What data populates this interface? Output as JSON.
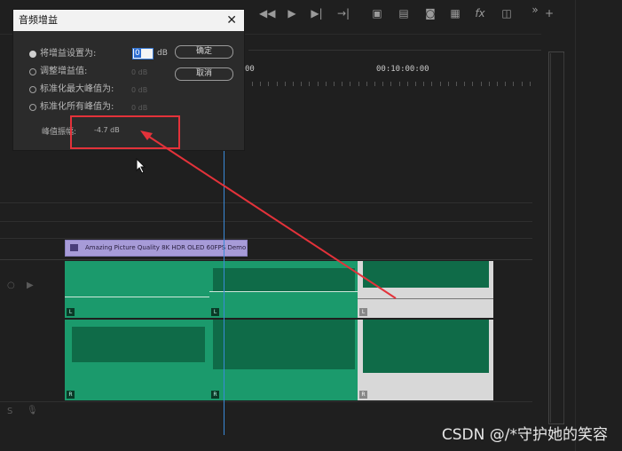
{
  "dialog": {
    "title": "音频增益",
    "close_glyph": "✕",
    "options": [
      {
        "label": "将增益设置为:",
        "selected": true
      },
      {
        "label": "调整增益值:",
        "value": "0 dB",
        "selected": false
      },
      {
        "label": "标准化最大峰值为:",
        "value": "0 dB",
        "selected": false
      },
      {
        "label": "标准化所有峰值为:",
        "value": "0 dB",
        "selected": false
      }
    ],
    "gain_value": "0",
    "gain_unit": "dB",
    "ok_label": "确定",
    "cancel_label": "取消",
    "peak_label": "峰值振幅:",
    "peak_value": "-4.7 dB"
  },
  "timeline": {
    "ruler_labels": [
      "00",
      "00:10:00:00"
    ],
    "clip_title": "Amazing Picture Quality 8K HDR OLED 60FPS Demo",
    "channel_labels": [
      "L",
      "R"
    ]
  },
  "toolbar_icons": [
    "mark-in-icon",
    "play-icon",
    "step-forward-icon",
    "go-to-out-icon",
    "lift-icon",
    "extract-icon",
    "camera-icon",
    "export-frame-icon",
    "fx-icon",
    "compare-icon",
    "more-icon",
    "add-icon"
  ],
  "watermark": "CSDN @/*守护她的笑容",
  "colors": {
    "clip_green": "#1b9a6c",
    "clip_label": "#a79bd8",
    "annotation": "#e3323a",
    "playhead": "#3a8ad8"
  }
}
